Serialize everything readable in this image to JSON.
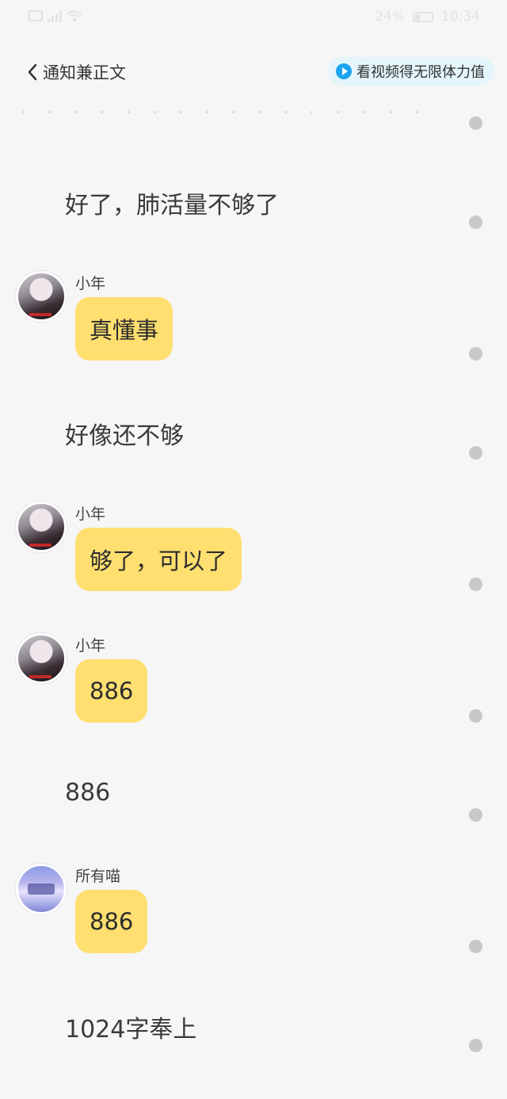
{
  "status_bar": {
    "battery": "24%",
    "time": "10:34"
  },
  "header": {
    "back_label": "通知兼正文",
    "video_button": "看视频得无限体力值"
  },
  "messages": [
    {
      "type": "narration",
      "text": "好了，肺活量不够了"
    },
    {
      "type": "bubble",
      "name": "小年",
      "text": "真懂事",
      "avatar": "girl-avatar"
    },
    {
      "type": "narration",
      "text": "好像还不够"
    },
    {
      "type": "bubble",
      "name": "小年",
      "text": "够了，可以了",
      "avatar": "girl-avatar"
    },
    {
      "type": "bubble",
      "name": "小年",
      "text": "886",
      "avatar": "girl-avatar"
    },
    {
      "type": "narration",
      "text": "886"
    },
    {
      "type": "bubble",
      "name": "所有喵",
      "text": "886",
      "avatar": "scene-avatar"
    },
    {
      "type": "narration",
      "text": "1024字奉上"
    }
  ],
  "colors": {
    "background": "#f6f6f6",
    "bubble": "#ffdf70",
    "video_button_bg": "#e4f6fb",
    "play_icon": "#1aa3f0",
    "side_dot": "#c8c8c8"
  }
}
